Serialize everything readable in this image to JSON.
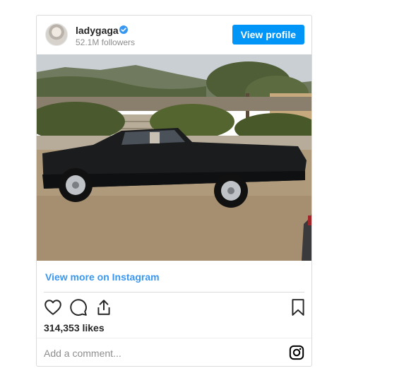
{
  "post": {
    "username": "ladygaga",
    "followers": "52.1M followers",
    "view_profile_label": "View profile",
    "view_more_label": "View more on Instagram",
    "likes": "314,353 likes",
    "comment_placeholder": "Add a comment...",
    "verified": true
  },
  "icons": {
    "like": "heart-icon",
    "comment": "comment-icon",
    "share": "share-icon",
    "save": "bookmark-icon",
    "brand": "instagram-icon"
  },
  "colors": {
    "accent": "#0095f6",
    "link": "#3897f0",
    "verified": "#3897f0",
    "text": "#262626",
    "muted": "#8e8e8e"
  }
}
